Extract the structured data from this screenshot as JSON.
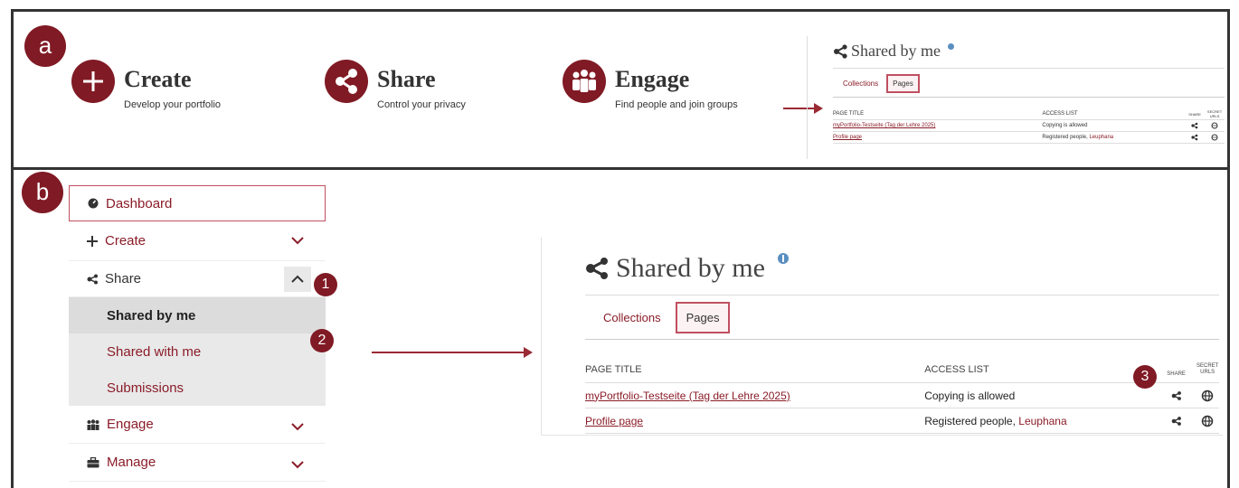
{
  "markers": {
    "a": "a",
    "b": "b"
  },
  "features": [
    {
      "title": "Create",
      "desc": "Develop your portfolio",
      "icon": "plus-icon"
    },
    {
      "title": "Share",
      "desc": "Control your privacy",
      "icon": "share-icon"
    },
    {
      "title": "Engage",
      "desc": "Find people and join groups",
      "icon": "people-icon"
    }
  ],
  "shared_panel": {
    "title": "Shared by me",
    "tabs": [
      "Collections",
      "Pages"
    ],
    "active_tab": "Pages",
    "columns": {
      "page_title": "PAGE TITLE",
      "access_list": "ACCESS LIST",
      "share": "SHARE",
      "secret_urls": "SECRET URLS"
    },
    "rows": [
      {
        "title": "myPortfolio-Testseite (Tag der Lehre 2025)",
        "access": "Copying is allowed",
        "access_link": ""
      },
      {
        "title": "Profile page",
        "access": "Registered people, ",
        "access_link": "Leuphana"
      }
    ]
  },
  "sidebar": {
    "items": [
      {
        "label": "Dashboard",
        "icon": "dashboard-icon"
      },
      {
        "label": "Create",
        "icon": "plus-icon"
      },
      {
        "label": "Share",
        "icon": "share-icon"
      },
      {
        "label": "Engage",
        "icon": "people-icon"
      },
      {
        "label": "Manage",
        "icon": "briefcase-icon"
      }
    ],
    "share_subitems": [
      "Shared by me",
      "Shared with me",
      "Submissions"
    ]
  },
  "badges": [
    "1",
    "2",
    "3"
  ],
  "colors": {
    "accent": "#801a24",
    "link": "#8a1c28",
    "info": "#5a8fc0"
  }
}
